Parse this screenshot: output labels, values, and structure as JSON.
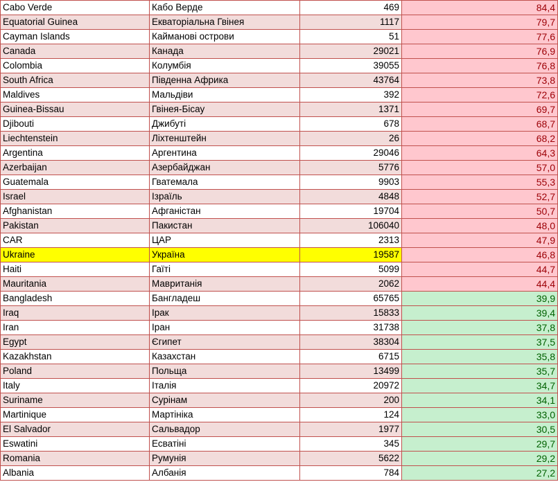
{
  "table": {
    "rows": [
      {
        "en": "Cabo Verde",
        "ua": "Кабо Верде",
        "count": "469",
        "value": "84,4",
        "status": "high"
      },
      {
        "en": "Equatorial Guinea",
        "ua": "Екваторіальна Гвінея",
        "count": "1117",
        "value": "79,7",
        "status": "high"
      },
      {
        "en": "Cayman Islands",
        "ua": "Кайманові острови",
        "count": "51",
        "value": "77,6",
        "status": "high"
      },
      {
        "en": "Canada",
        "ua": "Канада",
        "count": "29021",
        "value": "76,9",
        "status": "high"
      },
      {
        "en": "Colombia",
        "ua": "Колумбія",
        "count": "39055",
        "value": "76,8",
        "status": "high"
      },
      {
        "en": "South Africa",
        "ua": "Південна Африка",
        "count": "43764",
        "value": "73,8",
        "status": "high"
      },
      {
        "en": "Maldives",
        "ua": "Мальдіви",
        "count": "392",
        "value": "72,6",
        "status": "high"
      },
      {
        "en": "Guinea-Bissau",
        "ua": "Гвінея-Бісау",
        "count": "1371",
        "value": "69,7",
        "status": "high"
      },
      {
        "en": "Djibouti",
        "ua": "Джибуті",
        "count": "678",
        "value": "68,7",
        "status": "high"
      },
      {
        "en": "Liechtenstein",
        "ua": "Ліхтенштейн",
        "count": "26",
        "value": "68,2",
        "status": "high"
      },
      {
        "en": "Argentina",
        "ua": "Аргентина",
        "count": "29046",
        "value": "64,3",
        "status": "high"
      },
      {
        "en": "Azerbaijan",
        "ua": "Азербайджан",
        "count": "5776",
        "value": "57,0",
        "status": "high"
      },
      {
        "en": "Guatemala",
        "ua": "Гватемала",
        "count": "9903",
        "value": "55,3",
        "status": "high"
      },
      {
        "en": "Israel",
        "ua": "Ізраїль",
        "count": "4848",
        "value": "52,7",
        "status": "high"
      },
      {
        "en": "Afghanistan",
        "ua": "Афганістан",
        "count": "19704",
        "value": "50,7",
        "status": "high"
      },
      {
        "en": "Pakistan",
        "ua": "Пакистан",
        "count": "106040",
        "value": "48,0",
        "status": "high"
      },
      {
        "en": "CAR",
        "ua": "ЦАР",
        "count": "2313",
        "value": "47,9",
        "status": "high"
      },
      {
        "en": "Ukraine",
        "ua": "Україна",
        "count": "19587",
        "value": "46,8",
        "status": "high",
        "highlight": true
      },
      {
        "en": "Haiti",
        "ua": "Гаїті",
        "count": "5099",
        "value": "44,7",
        "status": "high"
      },
      {
        "en": "Mauritania",
        "ua": "Мавританія",
        "count": "2062",
        "value": "44,4",
        "status": "high"
      },
      {
        "en": "Bangladesh",
        "ua": "Бангладеш",
        "count": "65765",
        "value": "39,9",
        "status": "low"
      },
      {
        "en": "Iraq",
        "ua": "Ірак",
        "count": "15833",
        "value": "39,4",
        "status": "low"
      },
      {
        "en": "Iran",
        "ua": "Іран",
        "count": "31738",
        "value": "37,8",
        "status": "low"
      },
      {
        "en": "Egypt",
        "ua": "Єгипет",
        "count": "38304",
        "value": "37,5",
        "status": "low"
      },
      {
        "en": "Kazakhstan",
        "ua": "Казахстан",
        "count": "6715",
        "value": "35,8",
        "status": "low"
      },
      {
        "en": "Poland",
        "ua": "Польща",
        "count": "13499",
        "value": "35,7",
        "status": "low"
      },
      {
        "en": "Italy",
        "ua": "Італія",
        "count": "20972",
        "value": "34,7",
        "status": "low"
      },
      {
        "en": "Suriname",
        "ua": "Сурінам",
        "count": "200",
        "value": "34,1",
        "status": "low"
      },
      {
        "en": "Martinique",
        "ua": "Мартініка",
        "count": "124",
        "value": "33,0",
        "status": "low"
      },
      {
        "en": "El Salvador",
        "ua": "Сальвадор",
        "count": "1977",
        "value": "30,5",
        "status": "low"
      },
      {
        "en": "Eswatini",
        "ua": "Есватіні",
        "count": "345",
        "value": "29,7",
        "status": "low"
      },
      {
        "en": "Romania",
        "ua": "Румунія",
        "count": "5622",
        "value": "29,2",
        "status": "low"
      },
      {
        "en": "Albania",
        "ua": "Албанія",
        "count": "784",
        "value": "27,2",
        "status": "low"
      }
    ]
  },
  "colors": {
    "border": "#c0504d",
    "band": "#f2dcdb",
    "highlight": "#ffff00",
    "high_fill": "#ffc7ce",
    "high_text": "#9c0006",
    "low_fill": "#c6efce",
    "low_text": "#006100"
  }
}
